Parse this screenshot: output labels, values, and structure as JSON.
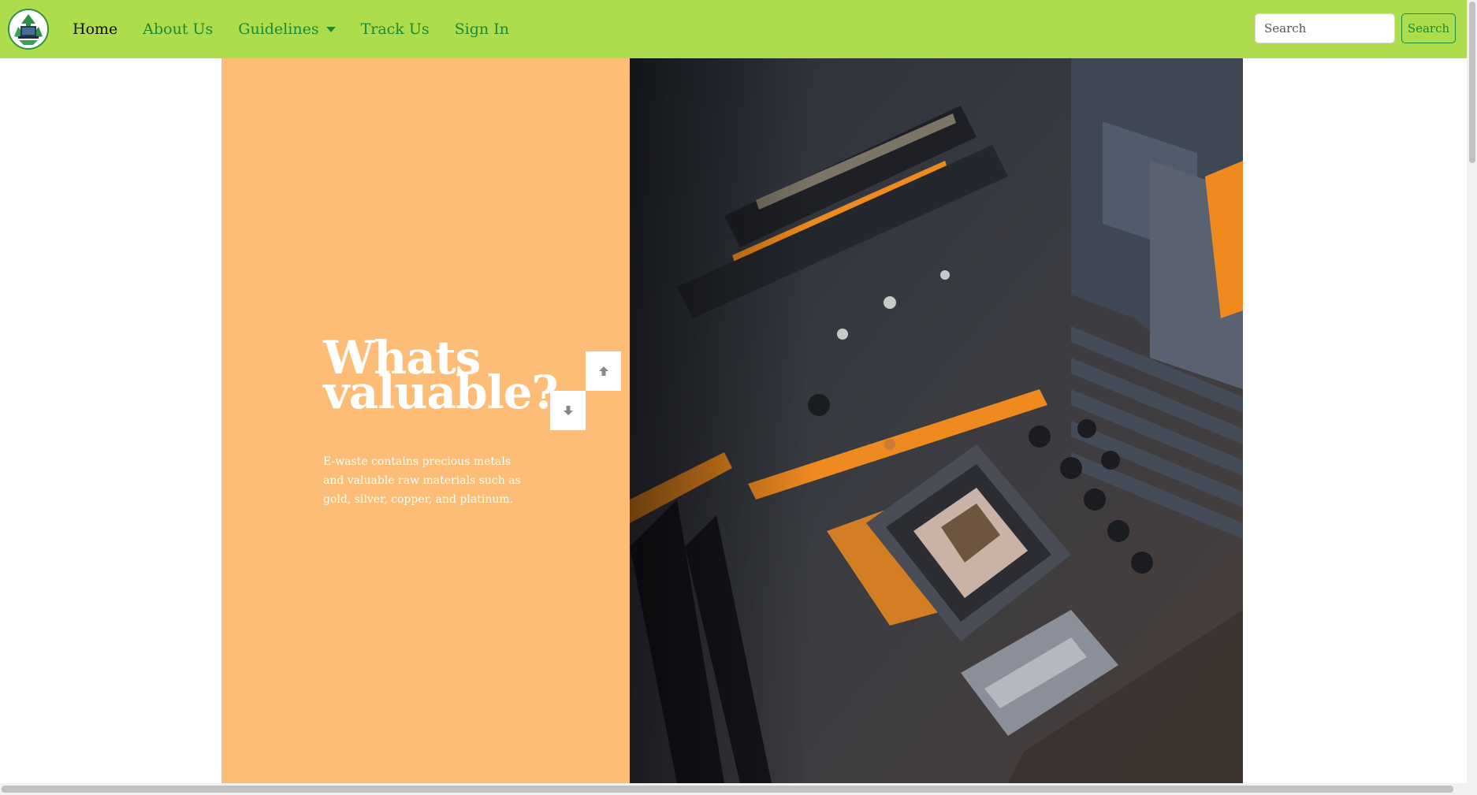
{
  "nav": {
    "logo_icon": "recycle-laptop-logo-icon",
    "links": [
      {
        "label": "Home",
        "active": true
      },
      {
        "label": "About Us"
      },
      {
        "label": "Guidelines",
        "dropdown": true
      },
      {
        "label": "Track Us"
      },
      {
        "label": "Sign In"
      }
    ],
    "search": {
      "placeholder": "Search",
      "button_label": "Search"
    }
  },
  "hero": {
    "title_line1": "Whats",
    "title_line2": "valuable?",
    "text": "E-waste contains precious metals and valuable raw materials such as gold, silver, copper, and platinum.",
    "image": "motherboard-photo",
    "up_icon": "arrow-up-icon",
    "down_icon": "arrow-down-icon"
  },
  "colors": {
    "navbar": "#addc4c",
    "link": "#1e8a2f",
    "hero_panel": "#fdbd77"
  }
}
